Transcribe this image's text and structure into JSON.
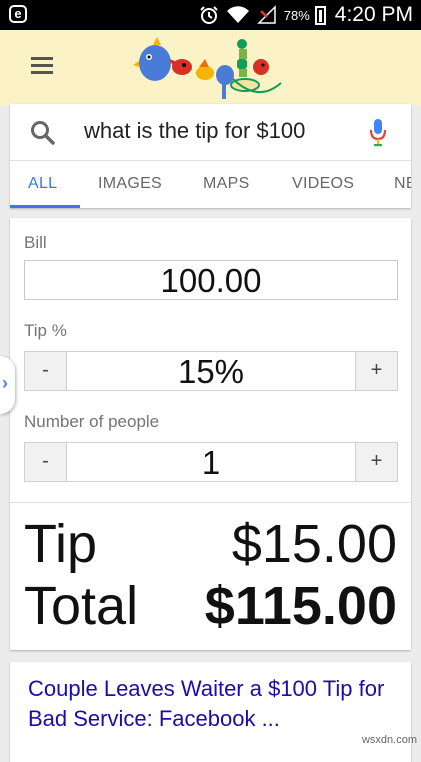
{
  "status_bar": {
    "app_icon": "e",
    "battery_percent": "78%",
    "time": "4:20 PM",
    "icons": [
      "alarm-icon",
      "wifi-icon",
      "no-signal-icon",
      "battery-icon"
    ]
  },
  "header": {
    "menu_icon": "hamburger-menu-icon",
    "doodle_icon": "google-doodle-logo"
  },
  "search": {
    "query": "what is the tip for $100",
    "search_icon": "search-icon",
    "mic_icon": "microphone-icon",
    "tabs": [
      {
        "label": "ALL",
        "active": true
      },
      {
        "label": "IMAGES",
        "active": false
      },
      {
        "label": "MAPS",
        "active": false
      },
      {
        "label": "VIDEOS",
        "active": false
      },
      {
        "label": "NEWS",
        "active": false
      }
    ]
  },
  "calculator": {
    "bill_label": "Bill",
    "bill_value": "100.00",
    "tip_label": "Tip %",
    "tip_value": "15%",
    "people_label": "Number of people",
    "people_value": "1",
    "minus_label": "-",
    "plus_label": "+",
    "tip_result_label": "Tip",
    "tip_result_value": "$15.00",
    "total_label": "Total",
    "total_value": "$115.00"
  },
  "first_result": {
    "title": "Couple Leaves Waiter a $100 Tip for Bad Service: Facebook ..."
  },
  "watermark": "wsxdn.com",
  "colors": {
    "accent_blue": "#3b78e7",
    "link_blue": "#1a0dab",
    "header_bg": "#fbf3c6"
  }
}
